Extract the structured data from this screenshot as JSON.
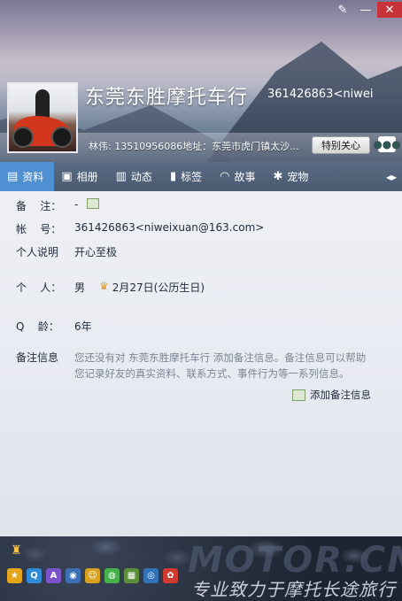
{
  "window": {
    "buttons": [
      {
        "icon": "brush-icon",
        "glyph": "✎"
      },
      {
        "icon": "minimize-icon",
        "glyph": "—"
      },
      {
        "icon": "close-icon",
        "glyph": "✕"
      }
    ]
  },
  "profile": {
    "name": "东莞东胜摩托车行",
    "qq_id": "361426863<niwei",
    "signature": "林伟: 13510956086地址：东莞市虎门镇太沙...",
    "special_care_label": "特别关心",
    "chat_icon": "chat-bubble-icon"
  },
  "tabs": [
    {
      "label": "资料",
      "icon": "id-card-icon",
      "glyph": "▤",
      "active": true
    },
    {
      "label": "相册",
      "icon": "photo-icon",
      "glyph": "▣",
      "active": false
    },
    {
      "label": "动态",
      "icon": "feed-icon",
      "glyph": "▥",
      "active": false
    },
    {
      "label": "标签",
      "icon": "bookmark-icon",
      "glyph": "▮",
      "active": false
    },
    {
      "label": "故事",
      "icon": "rainbow-icon",
      "glyph": "◠",
      "active": false
    },
    {
      "label": "宠物",
      "icon": "paw-icon",
      "glyph": "✱",
      "active": false
    }
  ],
  "tabs_more": "◂▸",
  "info": {
    "remark_label": "备    注：",
    "remark_value": "-",
    "account_label": "帐    号：",
    "account_value": "361426863<niweixuan@163.com>",
    "intro_label": "个人说明",
    "intro_value": "开心至极",
    "person_label": "个    人：",
    "gender": "男",
    "birthday": "2月27日(公历生日)",
    "age_label": "Q    龄：",
    "age_value": "6年",
    "note_label": "备注信息",
    "note_text": "您还没有对 东莞东胜摩托车行 添加备注信息。备注信息可以帮助您记录好友的真实资料、联系方式、事件行为等一系列信息。",
    "add_note_label": "添加备注信息"
  },
  "tray": [
    {
      "icon": "star-icon",
      "glyph": "★",
      "color": "#e5a518"
    },
    {
      "icon": "qzone-icon",
      "glyph": "Q",
      "color": "#2f8ad8"
    },
    {
      "icon": "app-icon",
      "glyph": "A",
      "color": "#7b52c9"
    },
    {
      "icon": "camera-icon",
      "glyph": "◉",
      "color": "#3d6fb6"
    },
    {
      "icon": "group-icon",
      "glyph": "☺",
      "color": "#d9a21e"
    },
    {
      "icon": "wechat-icon",
      "glyph": "◍",
      "color": "#46b04a"
    },
    {
      "icon": "gift-icon",
      "glyph": "▦",
      "color": "#5b8f3a"
    },
    {
      "icon": "eye-icon",
      "glyph": "◎",
      "color": "#3272b8"
    },
    {
      "icon": "pet-icon",
      "glyph": "✿",
      "color": "#cf3a30"
    }
  ],
  "tray_top_icon": "badge-icon",
  "watermark": {
    "logo": "MOTOR.CN",
    "slogan": "专业致力于摩托长途旅行"
  },
  "colors": {
    "active_tab": "#4f90d2",
    "close_button": "#c8333a"
  }
}
